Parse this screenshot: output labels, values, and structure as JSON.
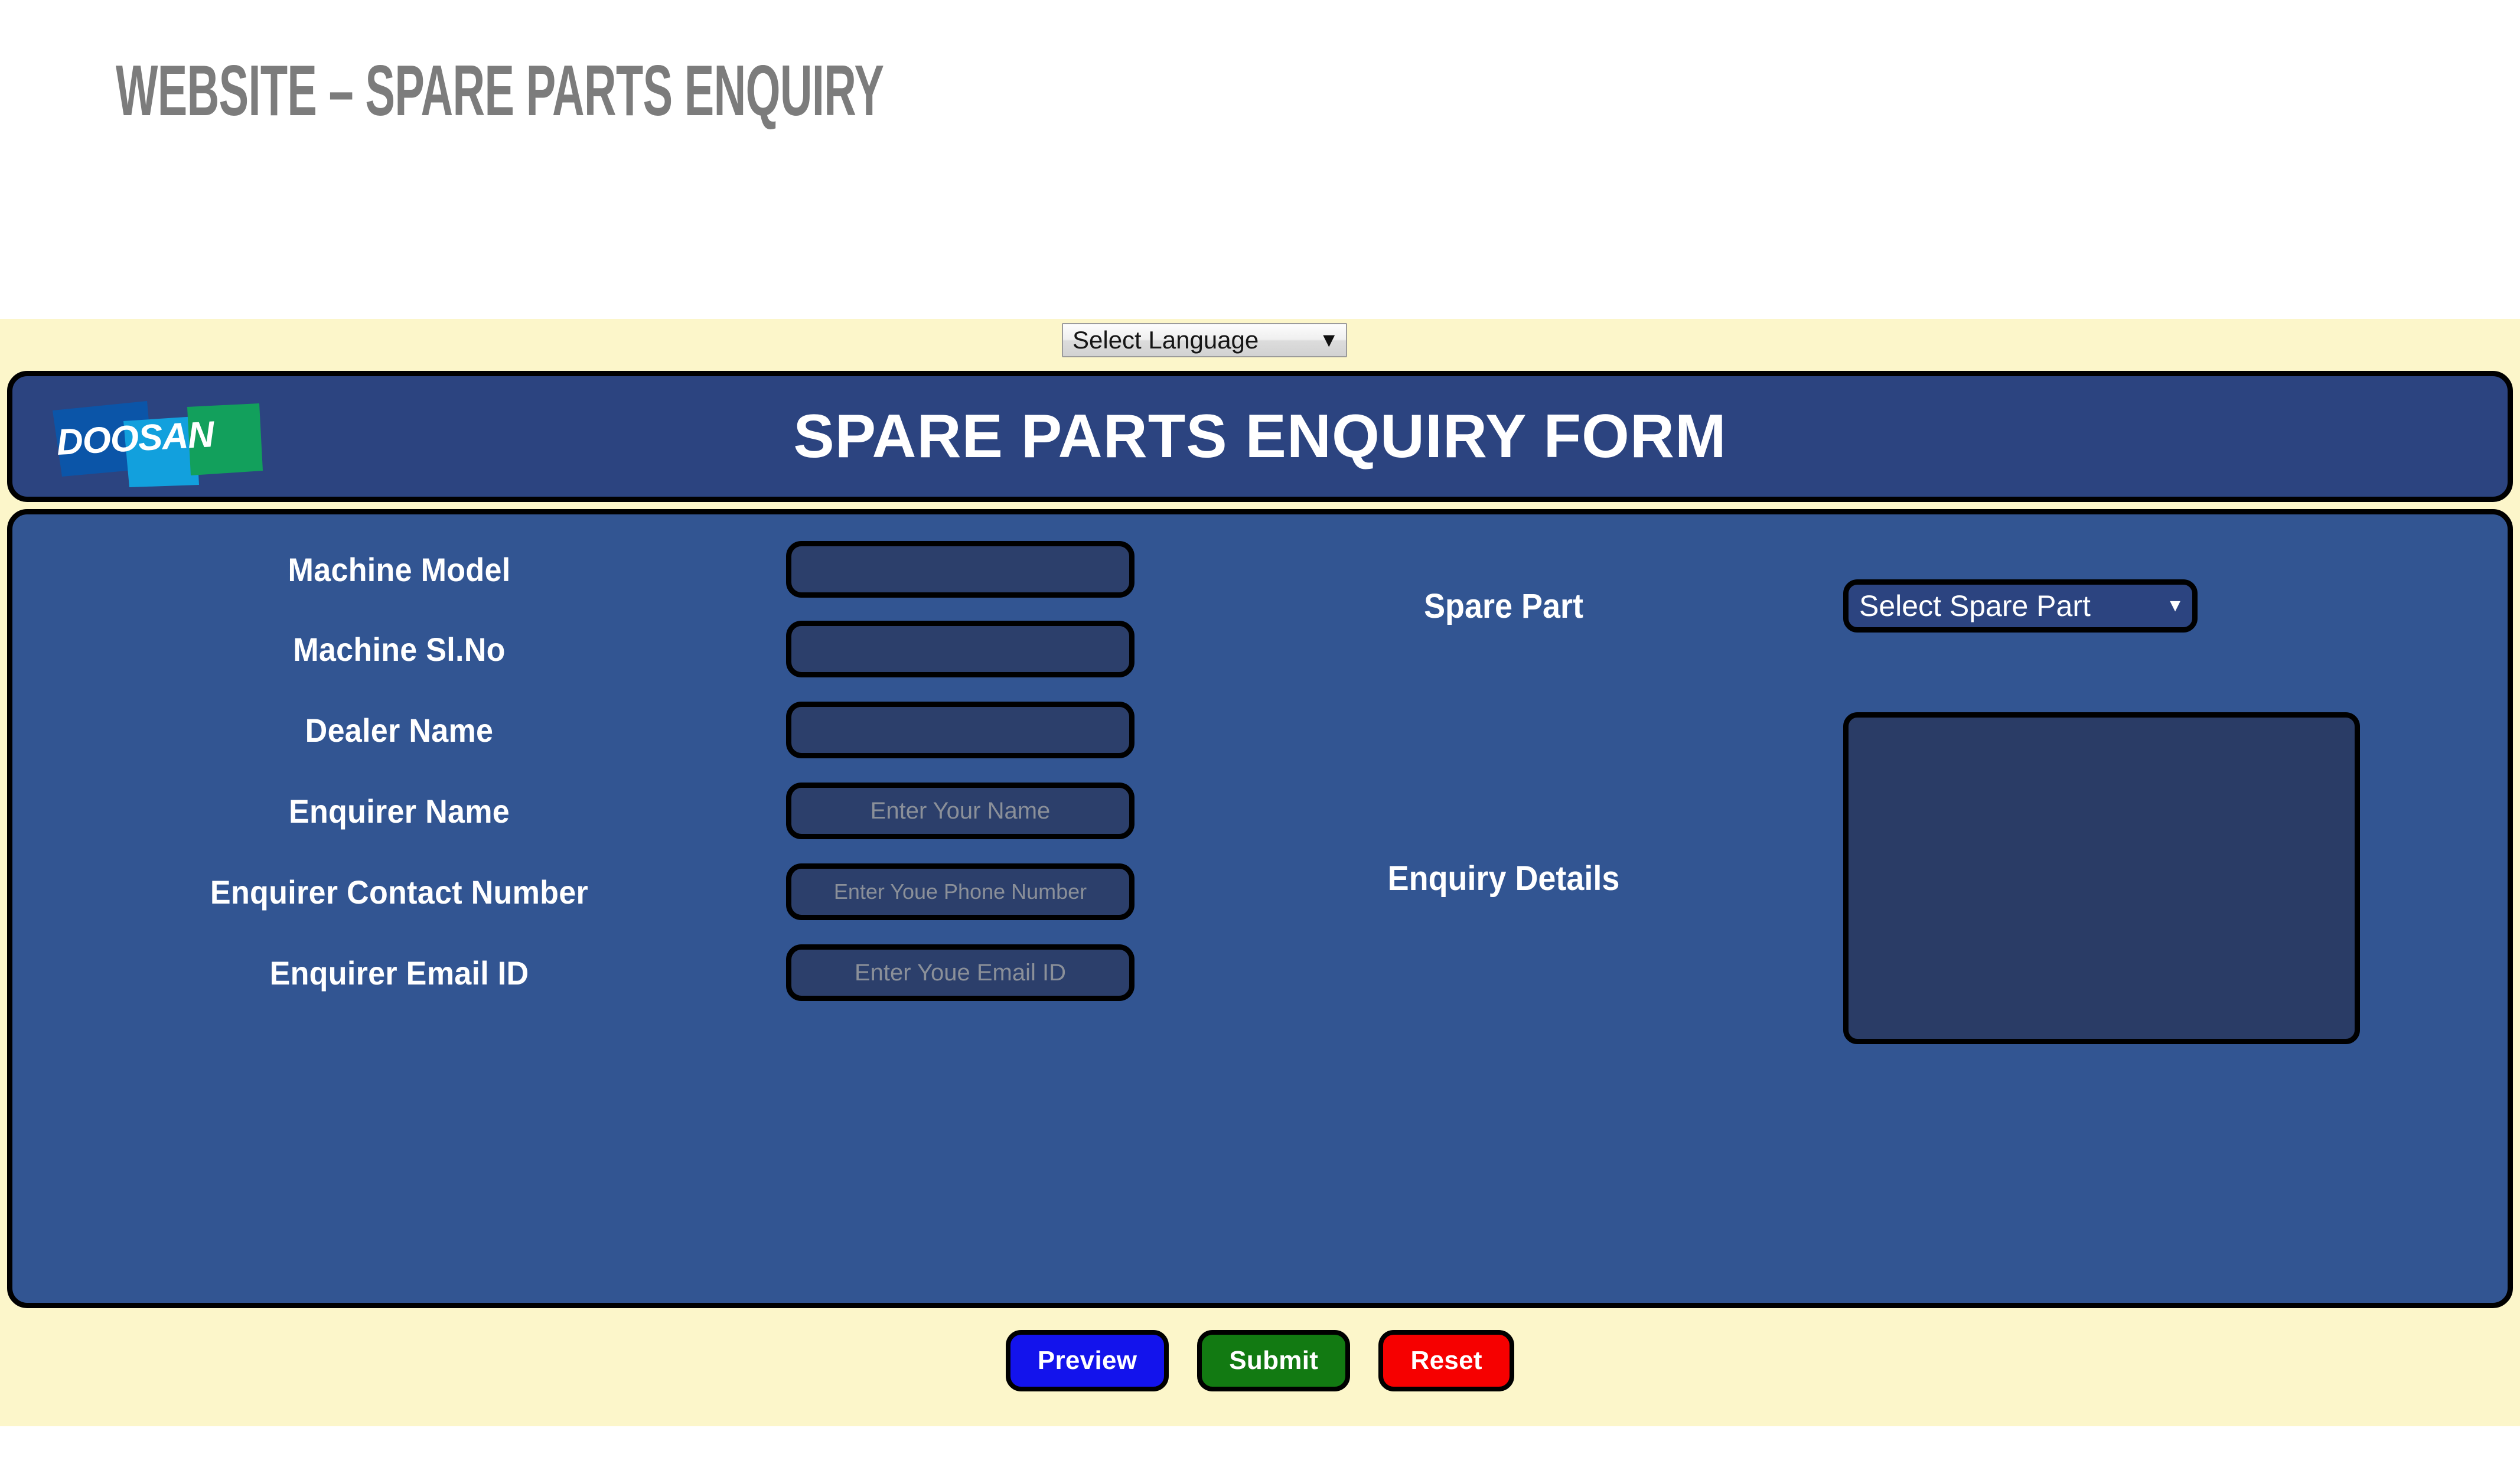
{
  "slide": {
    "title": "WEBSITE – SPARE PARTS ENQUIRY"
  },
  "page": {
    "background_color": "#fcf6ca",
    "panel_color": "#325592",
    "header_color": "#2c4480",
    "input_color": "#2c3f6b",
    "border_color": "#000000"
  },
  "language_selector": {
    "label": "Select Language",
    "arrow": "▼"
  },
  "header": {
    "title": "SPARE PARTS ENQUIRY FORM",
    "logo": {
      "text": "DOOSAN",
      "shape_colors": [
        "#0b55a8",
        "#12a0dd",
        "#12a05c"
      ],
      "text_color": "#ffffff"
    }
  },
  "form": {
    "left_fields": [
      {
        "label": "Machine Model",
        "placeholder": "",
        "value": ""
      },
      {
        "label": "Machine Sl.No",
        "placeholder": "",
        "value": ""
      },
      {
        "label": "Dealer Name",
        "placeholder": "",
        "value": ""
      },
      {
        "label": "Enquirer Name",
        "placeholder": "Enter Your Name",
        "value": ""
      },
      {
        "label": "Enquirer Contact Number",
        "placeholder": "Enter Youe Phone Number",
        "value": ""
      },
      {
        "label": "Enquirer Email ID",
        "placeholder": "Enter Youe Email ID",
        "value": ""
      }
    ],
    "right_fields": {
      "spare_part": {
        "label": "Spare Part",
        "selected": "Select Spare Part",
        "arrow": "▼"
      },
      "enquiry_details": {
        "label": "Enquiry Details",
        "value": "",
        "placeholder": ""
      }
    }
  },
  "actions": {
    "preview": {
      "label": "Preview",
      "color": "#1313ec"
    },
    "submit": {
      "label": "Submit",
      "color": "#127a12"
    },
    "reset": {
      "label": "Reset",
      "color": "#f60000"
    }
  }
}
